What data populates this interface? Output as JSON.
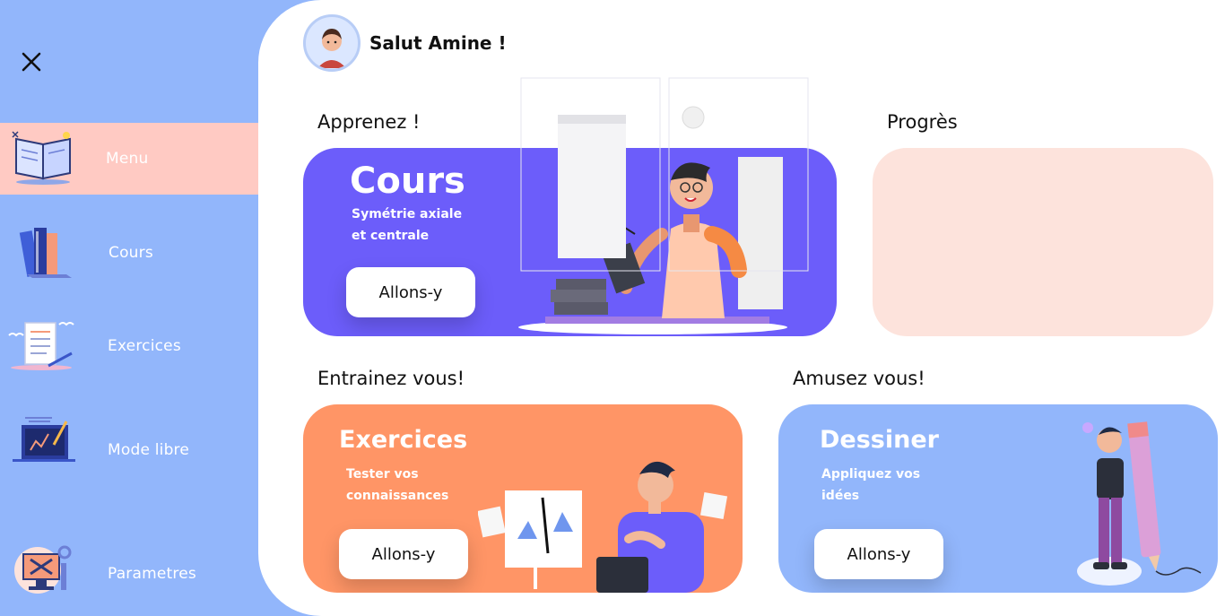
{
  "sidebar": {
    "items": [
      {
        "label": "Menu",
        "icon": "open-book-icon"
      },
      {
        "label": "Cours",
        "icon": "books-icon"
      },
      {
        "label": "Exercices",
        "icon": "checklist-icon"
      },
      {
        "label": "Mode libre",
        "icon": "drawing-board-icon"
      },
      {
        "label": "Parametres",
        "icon": "settings-monitor-icon"
      }
    ]
  },
  "header": {
    "greeting": "Salut Amine !"
  },
  "sections": {
    "learn": "Apprenez !",
    "progress": "Progrès",
    "train": "Entrainez vous!",
    "fun": "Amusez vous!"
  },
  "cards": {
    "cours": {
      "title": "Cours",
      "subtitle_line1": "Symétrie axiale",
      "subtitle_line2": "et centrale",
      "button": "Allons-y"
    },
    "exercices": {
      "title": "Exercices",
      "subtitle_line1": "Tester vos",
      "subtitle_line2": "connaissances",
      "button": "Allons-y"
    },
    "dessiner": {
      "title": "Dessiner",
      "subtitle_line1": "Appliquez vos",
      "subtitle_line2": "idées",
      "button": "Allons-y"
    }
  },
  "colors": {
    "sidebar": "#92b6fb",
    "active_item": "#ffcac3",
    "cours_card": "#6c5dfa",
    "exercices_card": "#ff9566",
    "dessiner_card": "#92b6fb",
    "progress_card": "#fde3dc"
  }
}
